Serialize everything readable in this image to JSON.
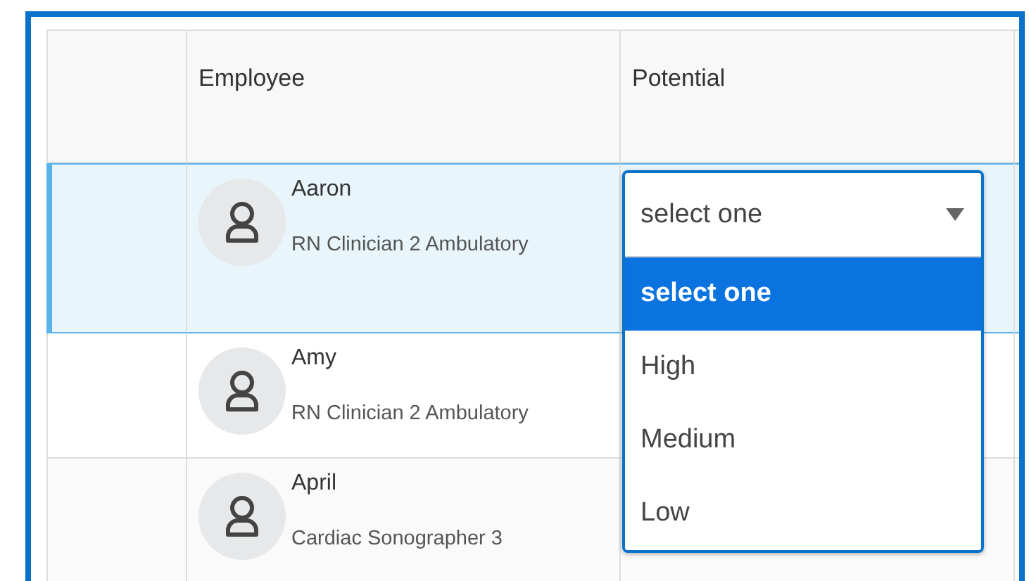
{
  "table": {
    "columns": [
      "Employee",
      "Potential"
    ],
    "rows": [
      {
        "name": "Aaron",
        "title": "RN Clinician 2 Ambulatory",
        "selected": true
      },
      {
        "name": "Amy",
        "title": "RN Clinician 2 Ambulatory",
        "selected": false
      },
      {
        "name": "April",
        "title": "Cardiac Sonographer 3",
        "selected": false
      }
    ]
  },
  "dropdown": {
    "value": "select one",
    "options": [
      {
        "label": "select one",
        "selected": true
      },
      {
        "label": "High",
        "selected": false
      },
      {
        "label": "Medium",
        "selected": false
      },
      {
        "label": "Low",
        "selected": false
      }
    ]
  }
}
